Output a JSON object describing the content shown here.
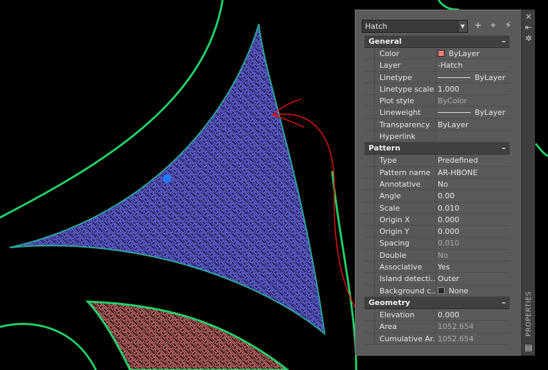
{
  "palette": {
    "selected_object": "Hatch",
    "side_title": "PROPERTIES",
    "sections": [
      {
        "title": "General",
        "collapse_label": "–",
        "rows": [
          {
            "label": "Color",
            "value": "ByLayer",
            "decor": "swatch"
          },
          {
            "label": "Layer",
            "value": "-Hatch"
          },
          {
            "label": "Linetype",
            "value": "ByLayer",
            "decor": "line"
          },
          {
            "label": "Linetype scale",
            "value": "1.000"
          },
          {
            "label": "Plot style",
            "value": "ByColor",
            "muted": true
          },
          {
            "label": "Lineweight",
            "value": "ByLayer",
            "decor": "line"
          },
          {
            "label": "Transparency",
            "value": "ByLayer"
          },
          {
            "label": "Hyperlink",
            "value": ""
          }
        ]
      },
      {
        "title": "Pattern",
        "collapse_label": "–",
        "rows": [
          {
            "label": "Type",
            "value": "Predefined"
          },
          {
            "label": "Pattern name",
            "value": "AR-HBONE"
          },
          {
            "label": "Annotative",
            "value": "No"
          },
          {
            "label": "Angle",
            "value": "0.00"
          },
          {
            "label": "Scale",
            "value": "0.010"
          },
          {
            "label": "Origin X",
            "value": "0.000"
          },
          {
            "label": "Origin Y",
            "value": "0.000"
          },
          {
            "label": "Spacing",
            "value": "0.010",
            "muted": true
          },
          {
            "label": "Double",
            "value": "No",
            "muted": true
          },
          {
            "label": "Associative",
            "value": "Yes"
          },
          {
            "label": "Island detecti...",
            "value": "Outer"
          },
          {
            "label": "Background c...",
            "value": "None",
            "decor": "none"
          }
        ]
      },
      {
        "title": "Geometry",
        "collapse_label": "–",
        "rows": [
          {
            "label": "Elevation",
            "value": "0.000"
          },
          {
            "label": "Area",
            "value": "1052.654",
            "muted": true
          },
          {
            "label": "Cumulative Ar...",
            "value": "1052.654",
            "muted": true
          }
        ]
      }
    ]
  },
  "colors": {
    "boundary": "#1fd36b",
    "hatch_blue": "#7b78ff",
    "hatch_red": "#e38686",
    "annotation": "#e01010",
    "grip": "#1e7bff"
  },
  "icons": {
    "close": "×",
    "autohide": "⇤",
    "settings": "✲",
    "toggle_pickadd": "+",
    "select_objects": "⌖",
    "quick_select": "⚡",
    "dropdown": "▼",
    "palette_menu": "▤"
  }
}
